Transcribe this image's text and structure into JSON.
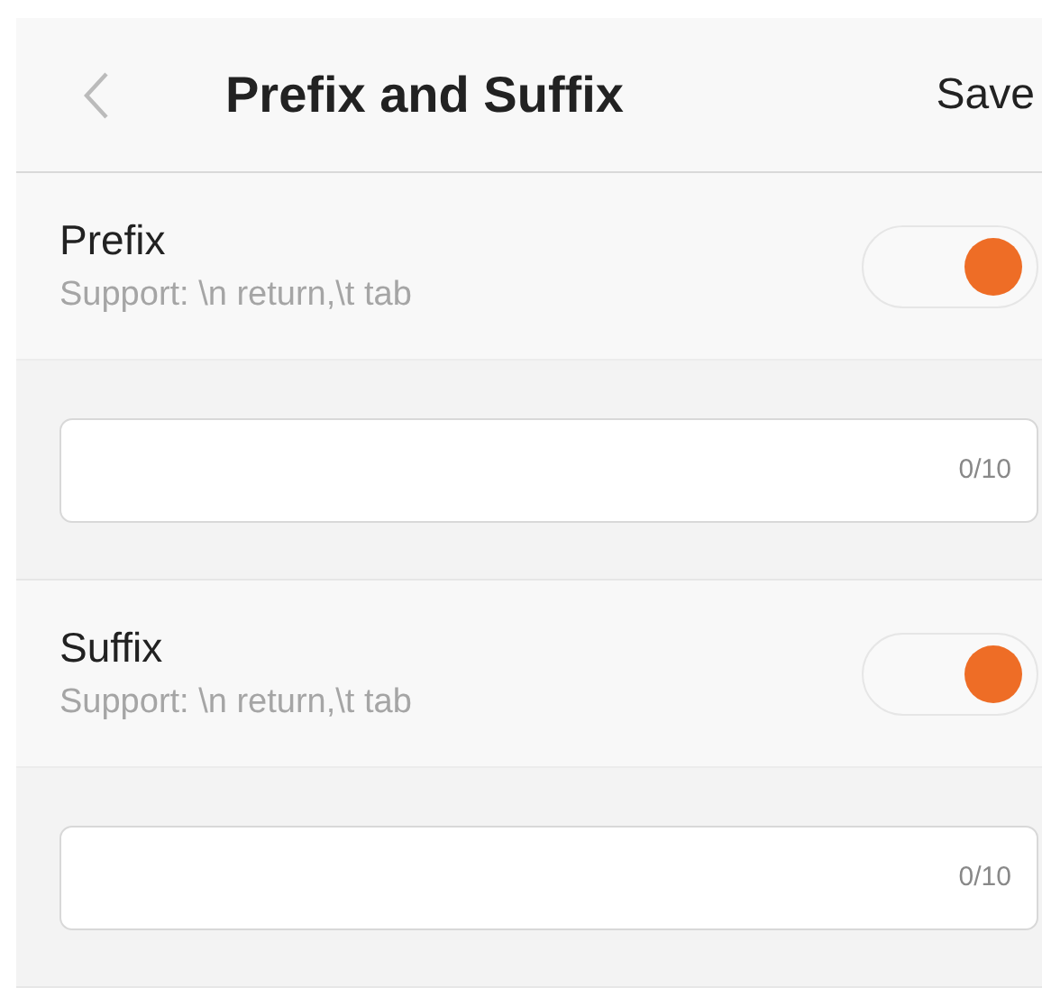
{
  "header": {
    "title": "Prefix and Suffix",
    "action": "Save"
  },
  "sections": [
    {
      "label": "Prefix",
      "hint": "Support: \\n return,\\t tab",
      "on": true,
      "counter": "0/10"
    },
    {
      "label": "Suffix",
      "hint": "Support: \\n return,\\t tab",
      "on": true,
      "counter": "0/10"
    }
  ]
}
